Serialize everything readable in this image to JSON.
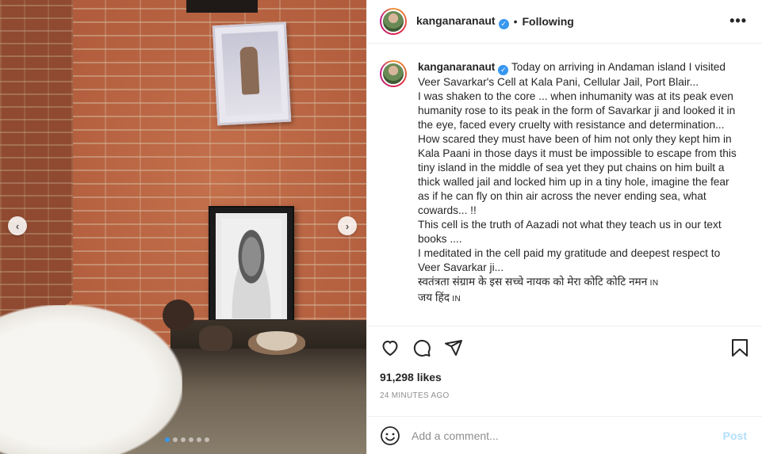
{
  "post": {
    "username": "kanganaranaut",
    "follow_status": "Following",
    "more_icon": "more-horizontal-icon",
    "caption_lines": [
      "Today on arriving in Andaman island I visited",
      "Veer Savarkar's Cell at Kala Pani, Cellular Jail, Port Blair...",
      "I was shaken to the core ... when inhumanity was at its peak even",
      "humanity rose to its peak in the form of Savarkar ji and looked it in",
      "the eye, faced every cruelty with resistance and determination...",
      "How scared they must have been of him not only they kept him in",
      "Kala Paani in those days it must be impossible to escape from this",
      "tiny island in the middle of sea yet they put chains on him built a",
      "thick walled jail and locked him up in a tiny hole, imagine the fear",
      "as if he can fly on thin air across the never ending sea, what",
      "cowards... !!",
      "This cell is the truth of Aazadi not what they teach us in our text",
      "books ....",
      "I meditated in the cell paid my gratitude and deepest respect to",
      "Veer Savarkar ji...",
      "स्वतंत्रता संग्राम के इस सच्चे नायक को मेरा कोटि कोटि नमन",
      "जय हिंद"
    ],
    "flag_tag": "IN",
    "likes": "91,298 likes",
    "timestamp": "24 MINUTES AGO",
    "comment_placeholder": "Add a comment...",
    "post_label": "Post",
    "carousel": {
      "total": 6,
      "active_index": 0
    },
    "colors": {
      "link_blue": "#3897f0",
      "post_disabled": "#b2dffc",
      "text": "#262626",
      "muted": "#8e8e8e"
    }
  }
}
